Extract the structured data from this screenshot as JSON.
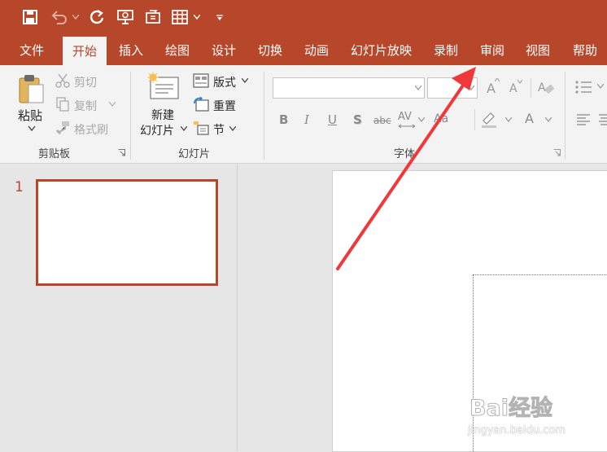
{
  "tabs": [
    "文件",
    "开始",
    "插入",
    "绘图",
    "设计",
    "切换",
    "动画",
    "幻灯片放映",
    "录制",
    "审阅",
    "视图",
    "帮助"
  ],
  "clipboard": {
    "paste": "粘贴",
    "cut": "剪切",
    "copy": "复制",
    "format_painter": "格式刷",
    "group": "剪贴板"
  },
  "slides": {
    "new_line1": "新建",
    "new_line2": "幻灯片",
    "layout": "版式",
    "reset": "重置",
    "section": "节",
    "group": "幻灯片"
  },
  "font": {
    "group": "字体",
    "bold": "B",
    "italic": "I",
    "underline": "U",
    "shadow": "S",
    "strike": "abc",
    "spacing": "AV",
    "case": "Aa",
    "grow": "A",
    "shrink": "A",
    "color": "A"
  },
  "thumbnail": {
    "number": "1"
  },
  "watermark": {
    "brand": "Bai经验",
    "url": "jingyan.baidu.com"
  },
  "colors": {
    "accent": "#b7472a",
    "arrow": "#f0383a"
  }
}
